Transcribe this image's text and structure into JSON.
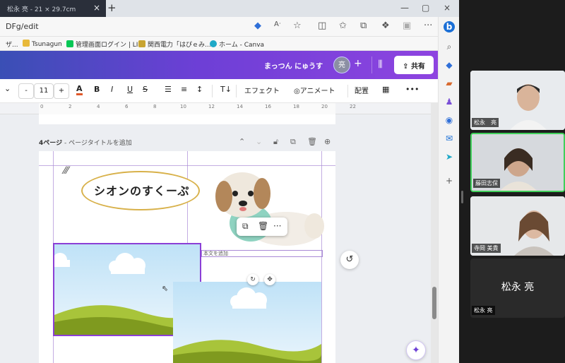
{
  "browser": {
    "tab_title": "松永 亮 - 21 × 29.7cm",
    "tab_close": "×",
    "new_tab": "+",
    "url": "DFg/edit",
    "window_controls": [
      "—",
      "▢",
      "×"
    ],
    "bookmarks": [
      {
        "label": "ザ...",
        "color": "#4a90d9"
      },
      {
        "label": "Tsunagun",
        "color": "#e8b93a"
      },
      {
        "label": "管理画面ログイン | LI...",
        "color": "#06c755"
      },
      {
        "label": "関西電力「はぴｅみ...",
        "color": "#c8a431"
      },
      {
        "label": "ホーム - Canva",
        "color": "#1ea8c7"
      }
    ]
  },
  "canva": {
    "team_name": "まっつん にゅうす",
    "avatar_initial": "亮",
    "share_label": "共有",
    "toolbar": {
      "minus": "-",
      "font_size": "11",
      "plus": "+",
      "text_color": "A",
      "bold": "B",
      "italic": "I",
      "underline": "U",
      "strike": "S",
      "effects": "エフェクト",
      "animate": "アニメート",
      "position": "配置",
      "more": "•••"
    },
    "ruler_marks": [
      "0",
      "2",
      "4",
      "6",
      "8",
      "10",
      "12",
      "14",
      "16",
      "18",
      "20",
      "22"
    ],
    "page": {
      "page_label": "4ページ",
      "page_title_placeholder": " - ページタイトルを追加",
      "heading": "シオンのすくーぷ",
      "text_placeholder": "本文を追加"
    }
  },
  "zoom": {
    "participants": [
      {
        "name": "松永　亮",
        "active": false
      },
      {
        "name": "藤田志保",
        "active": true
      },
      {
        "name": "寺岡 美貴",
        "active": false
      },
      {
        "name": "松永 亮",
        "display": "松永 亮",
        "active": false
      }
    ]
  },
  "colors": {
    "canva_gradient_start": "#3a4fb5",
    "canva_gradient_end": "#8e44e0",
    "selection": "#8b3fd6",
    "zoom_active": "#3fcf5a"
  }
}
